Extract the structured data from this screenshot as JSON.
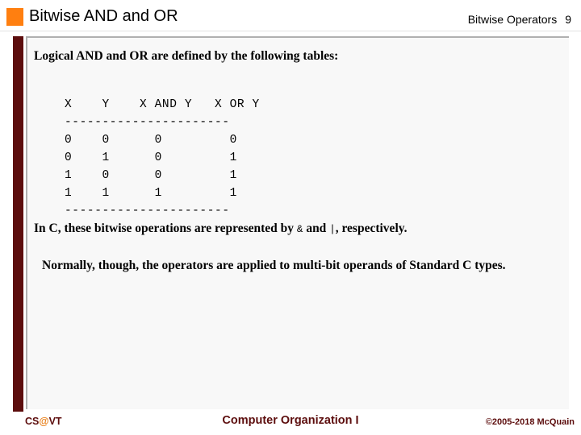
{
  "header": {
    "title": "Bitwise AND and OR",
    "subtitle": "Bitwise Operators",
    "slide_number": "9",
    "accent_color": "#ff7f10"
  },
  "content": {
    "intro": "Logical AND and OR are defined by the following tables:",
    "c_operators": {
      "prefix": "In C, these bitwise operations are represented by ",
      "and_operator": "&",
      "middle": " and ",
      "or_operator": "|",
      "suffix": ", respectively."
    },
    "normally": "Normally, though, the operators are applied to multi-bit operands of Standard C types.",
    "truth_table": {
      "columns": [
        "X",
        "Y",
        "X AND Y",
        "X OR Y"
      ],
      "header_line": "X    Y    X AND Y   X OR Y",
      "rule_line": "----------------------",
      "rows": [
        {
          "x": "0",
          "y": "0",
          "and": "0",
          "or": "0",
          "text": "0    0      0         0"
        },
        {
          "x": "0",
          "y": "1",
          "and": "0",
          "or": "1",
          "text": "0    1      0         1"
        },
        {
          "x": "1",
          "y": "0",
          "and": "0",
          "or": "1",
          "text": "1    0      0         1"
        },
        {
          "x": "1",
          "y": "1",
          "and": "1",
          "or": "1",
          "text": "1    1      1         1"
        }
      ],
      "block": "X    Y    X AND Y   X OR Y\n----------------------\n0    0      0         0\n0    1      0         1\n1    0      0         1\n1    1      1         1\n----------------------"
    }
  },
  "footer": {
    "logo_prefix": "CS",
    "logo_at": "@",
    "logo_suffix": "VT",
    "course": "Computer Organization I",
    "copyright": "©2005-2018 McQuain",
    "brand_color": "#5c0d0d",
    "accent_color": "#e8801b"
  }
}
